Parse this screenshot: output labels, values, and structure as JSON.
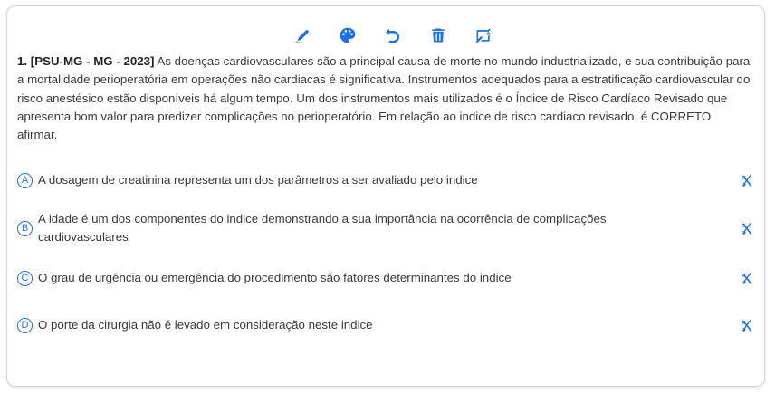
{
  "toolbar": {
    "icons": [
      "marker-icon",
      "palette-icon",
      "undo-icon",
      "trash-icon",
      "image-off-icon"
    ]
  },
  "question": {
    "source": "1. [PSU-MG - MG - 2023]",
    "text": " As doenças cardiovasculares são a principal causa de morte no mundo industrializado, e sua contribuição para a mortalidade perioperatória em operações não cardiacas é significativa. Instrumentos adequados para a estratificação cardiovascular do risco anestésico estão disponíveis há algum tempo. Um dos instrumentos mais utilizados é o Índice de Risco Cardíaco Revisado que apresenta bom valor para predizer complicações no perioperatório. Em relação ao indice de risco cardiaco revisado, é CORRETO afirmar."
  },
  "options": [
    {
      "letter": "A",
      "text": "A dosagem de creatinina representa um dos parâmetros a ser avaliado pelo indice"
    },
    {
      "letter": "B",
      "text": "A idade é um dos componentes do indice demonstrando a sua importância na ocorrência de complicações cardiovasculares"
    },
    {
      "letter": "C",
      "text": "O grau de urgência ou emergência do procedimento são fatores determinantes do indice"
    },
    {
      "letter": "D",
      "text": "O porte da cirurgia não é levado em consideração neste indice"
    }
  ],
  "colors": {
    "accent": "#1e6fe8",
    "text": "#3a3a3a",
    "border": "#cfd6e0"
  }
}
